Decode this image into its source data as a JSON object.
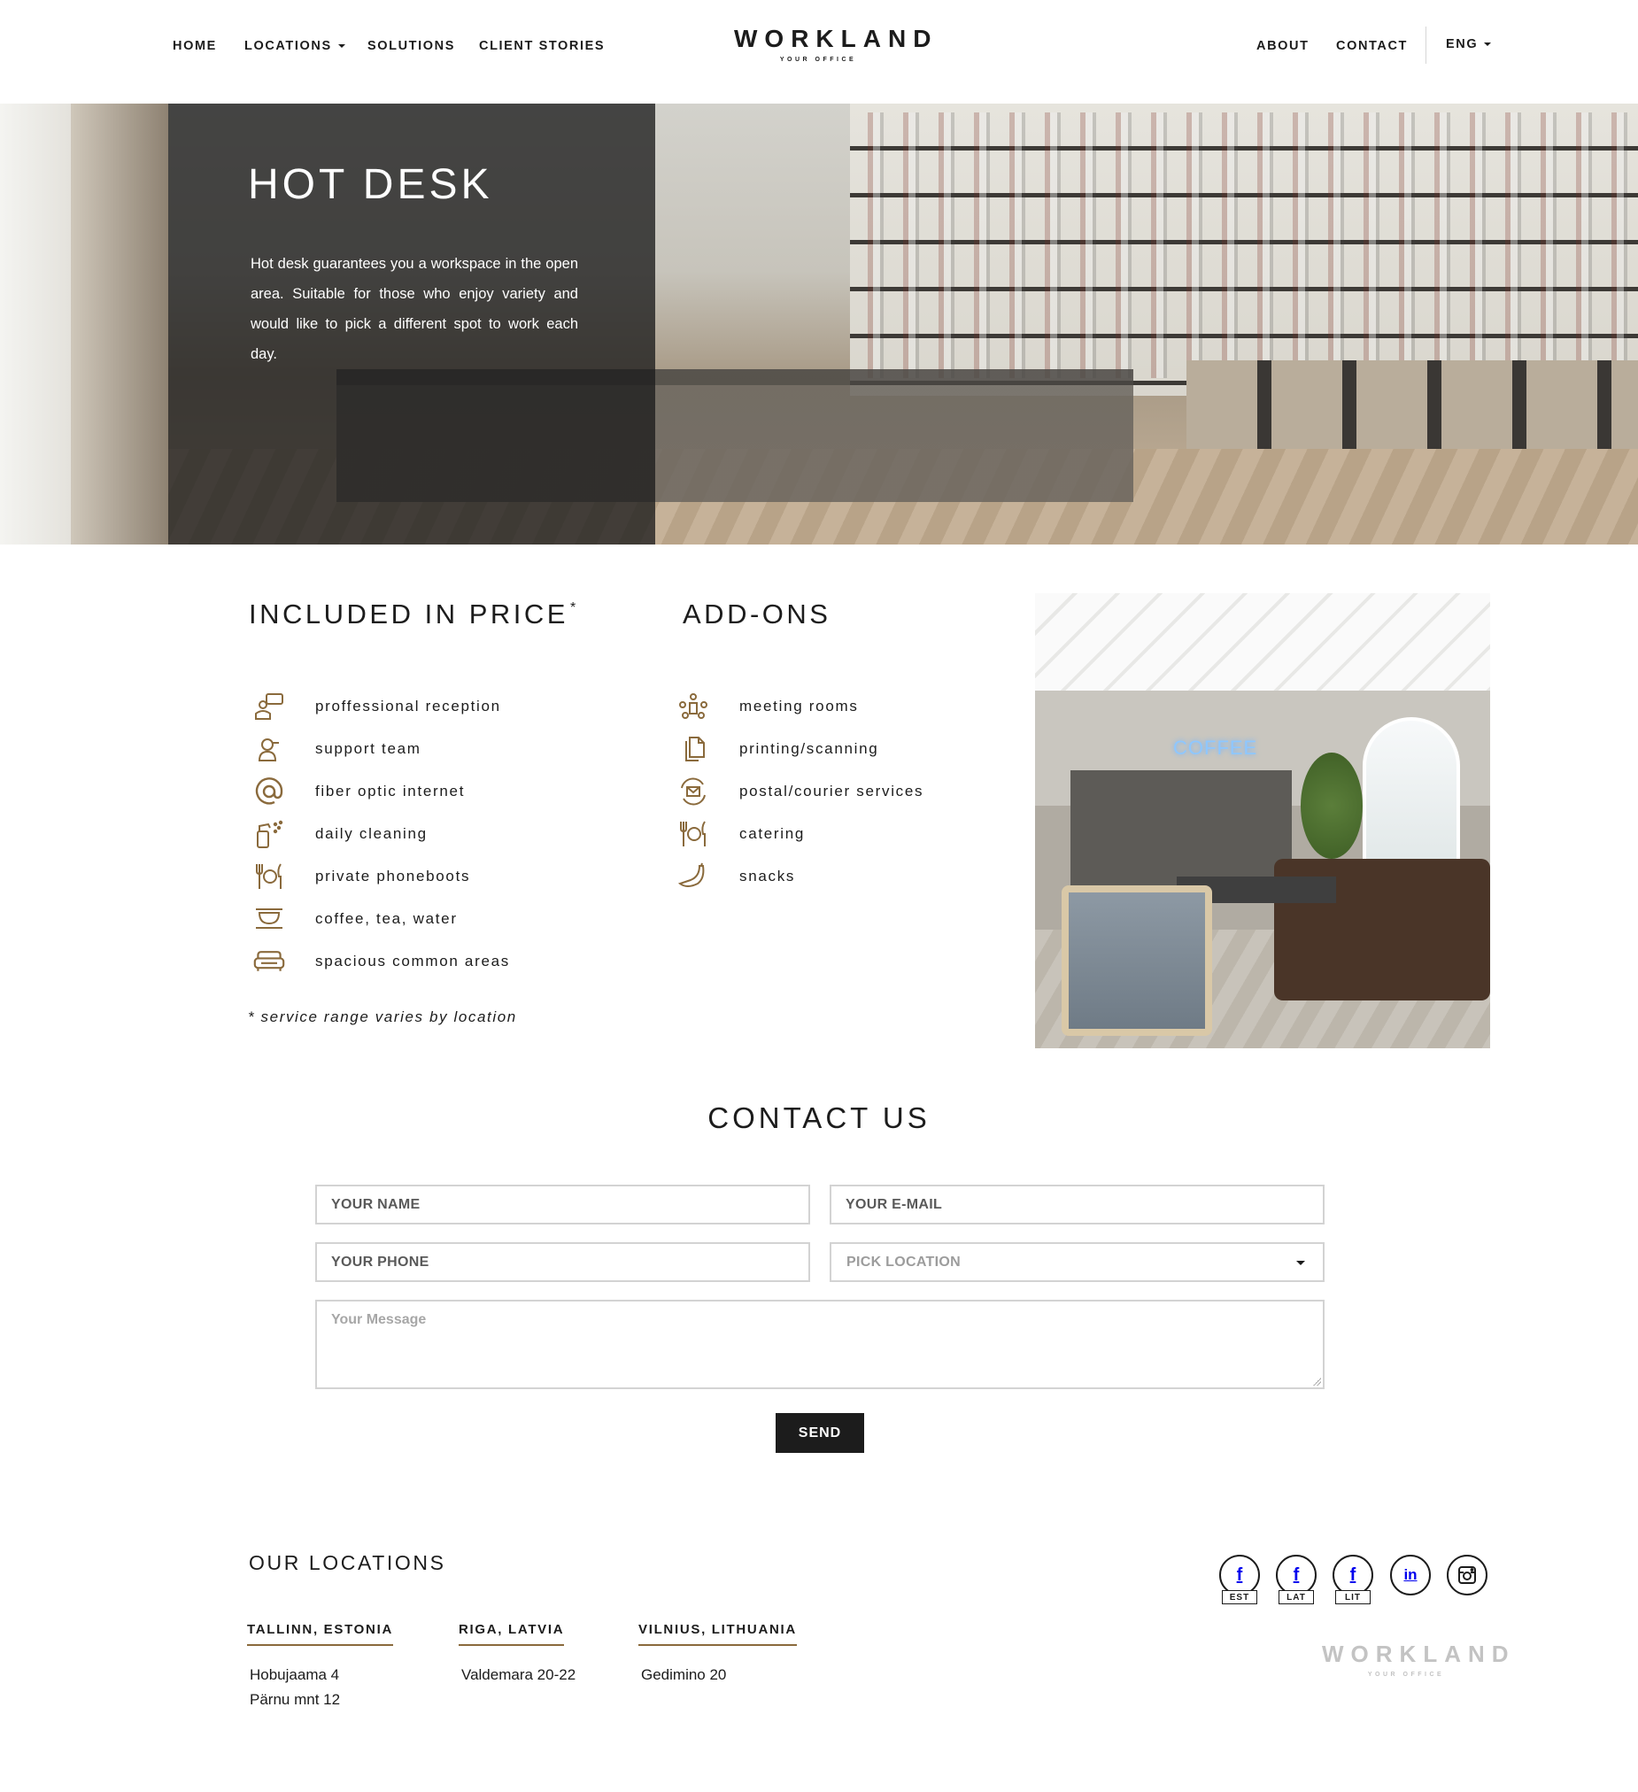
{
  "nav": {
    "left": [
      {
        "label": "HOME",
        "dropdown": false
      },
      {
        "label": "LOCATIONS",
        "dropdown": true
      },
      {
        "label": "SOLUTIONS",
        "dropdown": false
      },
      {
        "label": "CLIENT STORIES",
        "dropdown": false
      }
    ],
    "right": [
      {
        "label": "ABOUT"
      },
      {
        "label": "CONTACT"
      }
    ],
    "language": "ENG"
  },
  "logo": {
    "word": "WORKLAND",
    "tagline": "YOUR OFFICE"
  },
  "hero": {
    "title": "HOT DESK",
    "text": "Hot desk guarantees you a workspace in the open area. Suitable for those who enjoy variety and would like to pick a different spot to work each day."
  },
  "included": {
    "title": "INCLUDED IN PRICE",
    "title_mark": "*",
    "items": [
      {
        "label": "proffessional reception",
        "icon": "reception-icon"
      },
      {
        "label": "support team",
        "icon": "support-icon"
      },
      {
        "label": "fiber optic internet",
        "icon": "at-sign-icon"
      },
      {
        "label": "daily cleaning",
        "icon": "cleaning-spray-icon"
      },
      {
        "label": "private phoneboots",
        "icon": "cutlery-icon"
      },
      {
        "label": "coffee, tea, water",
        "icon": "cup-icon"
      },
      {
        "label": "spacious common areas",
        "icon": "sofa-icon"
      }
    ],
    "note": "* service range varies by location"
  },
  "addons": {
    "title": "ADD-ONS",
    "items": [
      {
        "label": "meeting rooms",
        "icon": "meeting-icon"
      },
      {
        "label": "printing/scanning",
        "icon": "documents-icon"
      },
      {
        "label": "postal/courier services",
        "icon": "mail-icon"
      },
      {
        "label": "catering",
        "icon": "cutlery-icon"
      },
      {
        "label": "snacks",
        "icon": "banana-icon"
      }
    ]
  },
  "cafe_image": {
    "neon_sign": "COFFEE"
  },
  "contact": {
    "title": "CONTACT US",
    "name_placeholder": "YOUR NAME",
    "email_placeholder": "YOUR E-MAIL",
    "phone_placeholder": "YOUR PHONE",
    "location_placeholder": "PICK LOCATION",
    "message_placeholder": "Your Message",
    "send_label": "SEND"
  },
  "footer": {
    "title": "OUR LOCATIONS",
    "cities": [
      {
        "name": "TALLINN, ESTONIA",
        "addresses": [
          "Hobujaama 4",
          "Pärnu mnt 12"
        ]
      },
      {
        "name": "RIGA, LATVIA",
        "addresses": [
          "Valdemara 20-22"
        ]
      },
      {
        "name": "VILNIUS, LITHUANIA",
        "addresses": [
          "Gedimino 20"
        ]
      }
    ],
    "social": [
      {
        "icon": "facebook-icon",
        "glyph": "f",
        "tag": "EST"
      },
      {
        "icon": "facebook-icon",
        "glyph": "f",
        "tag": "LAT"
      },
      {
        "icon": "facebook-icon",
        "glyph": "f",
        "tag": "LIT"
      },
      {
        "icon": "linkedin-icon",
        "glyph": "in",
        "tag": ""
      },
      {
        "icon": "instagram-icon",
        "glyph": "",
        "tag": ""
      }
    ]
  },
  "colors": {
    "accent": "#8a6a3c",
    "dark": "#1c1c1c",
    "border": "#d3d3d3"
  }
}
